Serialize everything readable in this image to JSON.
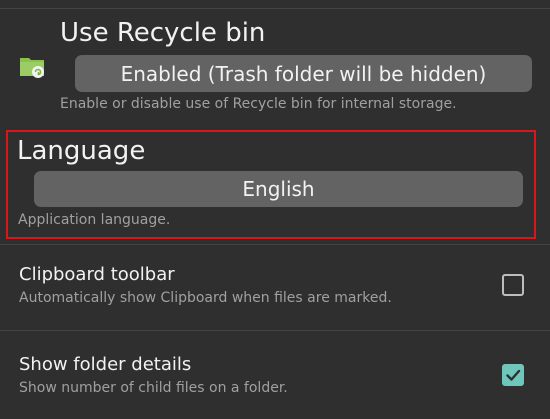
{
  "recycle_bin": {
    "title": "Use Recycle bin",
    "button_label": "Enabled (Trash folder will be hidden)",
    "description": "Enable or disable use of Recycle bin for internal storage.",
    "icon": "recycle-bin-folder-icon"
  },
  "language": {
    "title": "Language",
    "button_label": "English",
    "description": "Application language."
  },
  "clipboard_toolbar": {
    "title": "Clipboard toolbar",
    "description": "Automatically show Clipboard when files are marked.",
    "checked": false
  },
  "folder_details": {
    "title": "Show folder details",
    "description": "Show number of child files on a folder.",
    "checked": true
  },
  "colors": {
    "background": "#2f2f2f",
    "button": "#636363",
    "highlight": "#d9171b",
    "checkbox_checked": "#6fc6ba",
    "icon_green": "#8bc34a"
  }
}
